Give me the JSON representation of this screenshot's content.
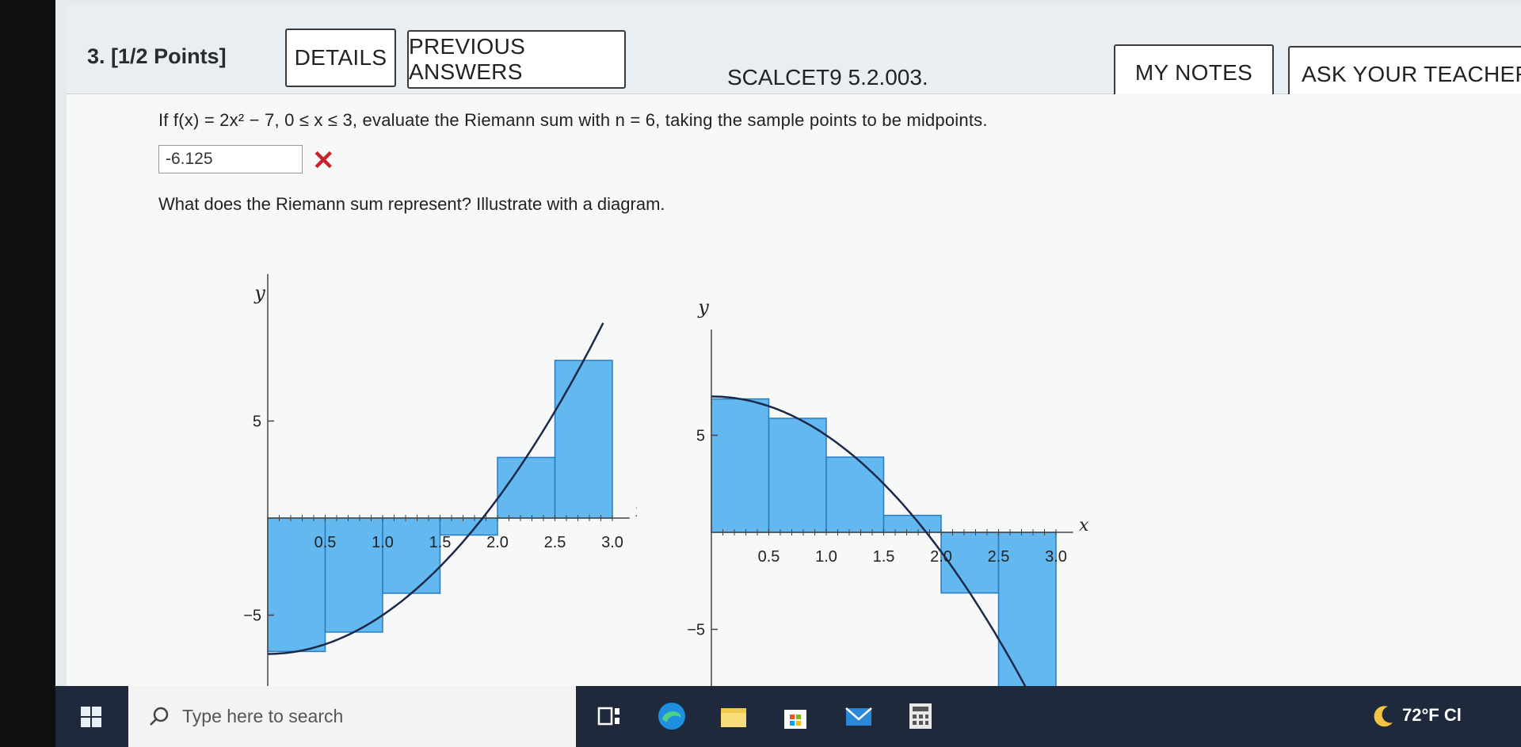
{
  "question": {
    "number": "3.",
    "points": "[1/2 Points]",
    "details_label": "DETAILS",
    "previous_answers_label": "PREVIOUS ANSWERS",
    "code": "SCALCET9 5.2.003.",
    "my_notes_label": "MY NOTES",
    "ask_teacher_label": "ASK YOUR TEACHER",
    "prompt": "If f(x) = 2x² − 7, 0 ≤ x ≤ 3, evaluate the Riemann sum with n = 6, taking the sample points to be midpoints.",
    "answer_value": "-6.125",
    "answer_status": "incorrect",
    "followup": "What does the Riemann sum represent? Illustrate with a diagram."
  },
  "chart_data": [
    {
      "type": "bar",
      "xlabel": "x",
      "ylabel": "y",
      "x_ticks": [
        "0.5",
        "1.0",
        "1.5",
        "2.0",
        "2.5",
        "3.0"
      ],
      "y_ticks": [
        "5",
        "−5"
      ],
      "intervals": [
        [
          0,
          0.5
        ],
        [
          0.5,
          1.0
        ],
        [
          1.0,
          1.5
        ],
        [
          1.5,
          2.0
        ],
        [
          2.0,
          2.5
        ],
        [
          2.5,
          3.0
        ]
      ],
      "values": [
        -6.875,
        -5.875,
        -3.875,
        -0.875,
        3.125,
        8.125
      ],
      "curve": "2x^2 - 7",
      "xlim": [
        0,
        3
      ],
      "ylim": [
        -7.5,
        9
      ]
    },
    {
      "type": "bar",
      "xlabel": "x",
      "ylabel": "y",
      "x_ticks": [
        "0.5",
        "1.0",
        "1.5",
        "2.0",
        "2.5",
        "3.0"
      ],
      "y_ticks": [
        "5",
        "−5"
      ],
      "intervals": [
        [
          0,
          0.5
        ],
        [
          0.5,
          1.0
        ],
        [
          1.0,
          1.5
        ],
        [
          1.5,
          2.0
        ],
        [
          2.0,
          2.5
        ],
        [
          2.5,
          3.0
        ]
      ],
      "values": [
        6.875,
        5.875,
        3.875,
        0.875,
        -3.125,
        -8.125
      ],
      "curve": "7 - 2x^2",
      "xlim": [
        0,
        3
      ],
      "ylim": [
        -8,
        7.5
      ]
    }
  ],
  "taskbar": {
    "search_placeholder": "Type here to search",
    "weather": "72°F Cl"
  },
  "colors": {
    "bar_fill": "#5ab4ee",
    "bar_stroke": "#2a7cc0",
    "curve": "#1b2a4a",
    "error": "#c8242e",
    "taskbar": "#1e2a3c"
  }
}
